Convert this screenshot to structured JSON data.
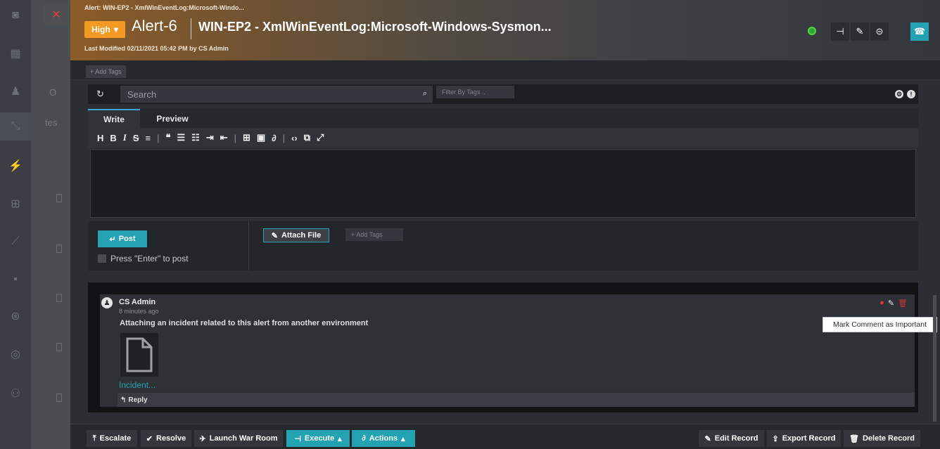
{
  "header": {
    "breadcrumb": "Alert: WIN-EP2 - XmlWinEventLog:Microsoft-Windo...",
    "severity": "High",
    "alert_name": "Alert-6",
    "alert_title": "WIN-EP2 - XmlWinEventLog:Microsoft-Windows-Sysmon...",
    "last_modified": "Last Modified 02/11/2021 05:42 PM by CS Admin",
    "add_tags": "+ Add Tags",
    "status_color": "#2aa72e"
  },
  "background": {
    "text_1": "O",
    "text_2": "tes"
  },
  "comments_panel": {
    "search_placeholder": "Search",
    "filter_tags_placeholder": "Filter By Tags ..",
    "tabs": [
      "Write",
      "Preview"
    ],
    "post_label": "Post",
    "enter_to_post": "Press \"Enter\" to post",
    "attach_label": "Attach File",
    "add_tags": "+ Add Tags"
  },
  "comment": {
    "author": "CS Admin",
    "time": "8 minutes ago",
    "text": "Attaching an incident related to this alert from another environment",
    "attachment_name": "Incident...",
    "reply_label": "Reply",
    "tooltip": "Mark Comment as Important"
  },
  "footer": {
    "escalate": "Escalate",
    "resolve": "Resolve",
    "war_room": "Launch War Room",
    "execute": "Execute",
    "actions": "Actions",
    "edit_record": "Edit Record",
    "export_record": "Export Record",
    "delete_record": "Delete Record"
  },
  "colors": {
    "accent": "#25a3b3",
    "severity_high": "#f39a24",
    "important": "#e0363a"
  }
}
